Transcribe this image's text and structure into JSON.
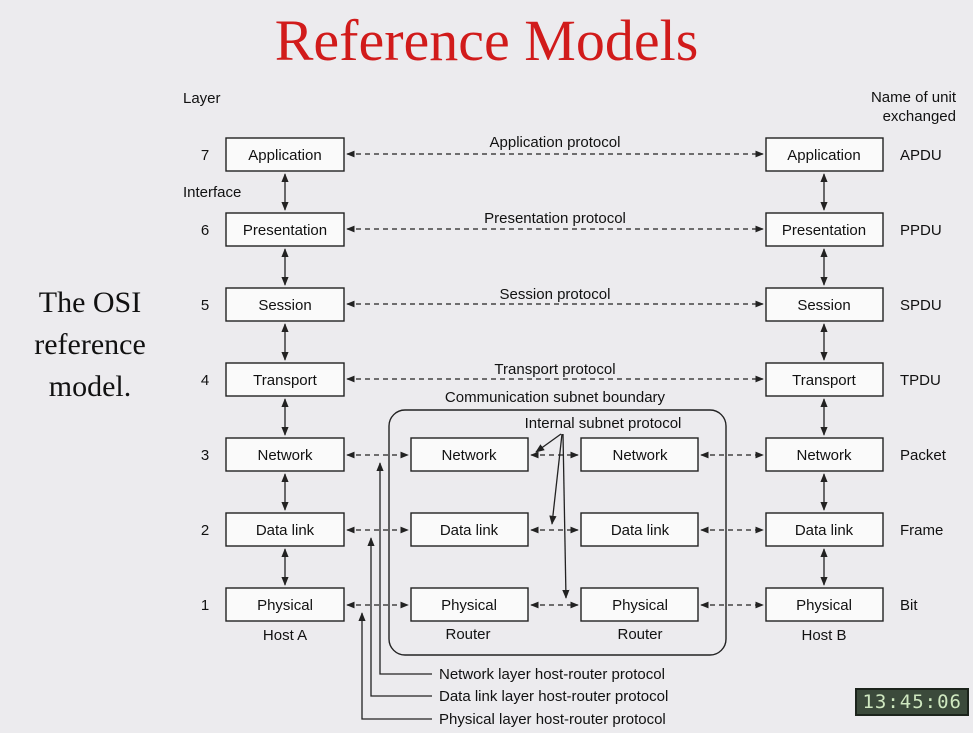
{
  "title": "Reference Models",
  "caption": [
    "The OSI",
    "reference",
    "model."
  ],
  "headers": {
    "layer": "Layer",
    "unit": [
      "Name of unit",
      "exchanged"
    ],
    "interface": "Interface"
  },
  "layer_numbers": [
    "7",
    "6",
    "5",
    "4",
    "3",
    "2",
    "1"
  ],
  "host_layers": [
    "Application",
    "Presentation",
    "Session",
    "Transport",
    "Network",
    "Data link",
    "Physical"
  ],
  "units": [
    "APDU",
    "PPDU",
    "SPDU",
    "TPDU",
    "Packet",
    "Frame",
    "Bit"
  ],
  "protocols": [
    "Application protocol",
    "Presentation protocol",
    "Session protocol",
    "Transport protocol"
  ],
  "router_layers": [
    "Network",
    "Data link",
    "Physical"
  ],
  "subnet_boundary": "Communication subnet boundary",
  "internal_protocol": "Internal subnet protocol",
  "labels": {
    "host_a": "Host A",
    "host_b": "Host B",
    "router": "Router"
  },
  "bottom_protocols": [
    "Network layer host-router protocol",
    "Data link layer host-router protocol",
    "Physical layer host-router protocol"
  ],
  "clock": "13:45:06"
}
